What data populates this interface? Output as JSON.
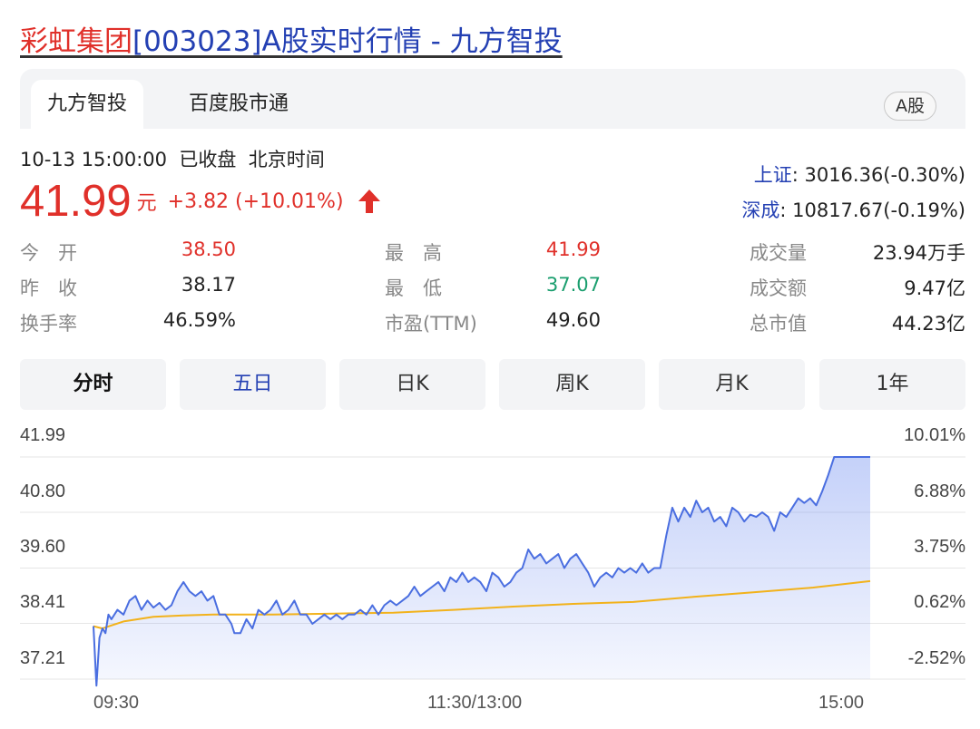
{
  "page": {
    "title_name": "彩虹集团",
    "title_rest": "[003023]A股实时行情 - 九方智投"
  },
  "tabs": [
    {
      "label": "九方智投",
      "active": true
    },
    {
      "label": "百度股市通",
      "active": false
    }
  ],
  "market_badge": "A股",
  "quote": {
    "datetime": "10-13 15:00:00",
    "status": "已收盘",
    "timezone": "北京时间",
    "price": "41.99",
    "unit": "元",
    "change": "+3.82 (+10.01%)",
    "color_up": "#e0302a",
    "color_down": "#1a9e6e"
  },
  "indices": [
    {
      "name": "上证",
      "value": ": 3016.36(-0.30%)"
    },
    {
      "name": "深成",
      "value": ": 10817.67(-0.19%)"
    }
  ],
  "stats": {
    "col1": [
      {
        "label": "今　开",
        "value": "38.50"
      },
      {
        "label": "昨　收",
        "value": "38.17"
      },
      {
        "label": "换手率",
        "value": "46.59%"
      }
    ],
    "col2": [
      {
        "label": "最　高",
        "value": "41.99"
      },
      {
        "label": "最　低",
        "value": "37.07"
      },
      {
        "label": "市盈(TTM)",
        "value": "49.60"
      }
    ],
    "col3": [
      {
        "label": "成交量",
        "value": "23.94万手"
      },
      {
        "label": "成交额",
        "value": "9.47亿"
      },
      {
        "label": "总市值",
        "value": "44.23亿"
      }
    ]
  },
  "ranges": [
    "分时",
    "五日",
    "日K",
    "周K",
    "月K",
    "1年"
  ],
  "chart_data": {
    "type": "line",
    "y_ticks": [
      "41.99",
      "40.80",
      "39.60",
      "38.41",
      "37.21"
    ],
    "y_pct_ticks": [
      "10.01%",
      "6.88%",
      "3.75%",
      "0.62%",
      "-2.52%"
    ],
    "x_ticks": [
      "09:30",
      "11:30/13:00",
      "15:00"
    ],
    "ylim": [
      37.21,
      41.99
    ],
    "prev_close": 38.17,
    "series": [
      {
        "role": "price",
        "color": "#4a6ee0",
        "points": [
          [
            0,
            38.35
          ],
          [
            1,
            37.07
          ],
          [
            2,
            38.1
          ],
          [
            3,
            38.3
          ],
          [
            4,
            38.2
          ],
          [
            5,
            38.6
          ],
          [
            6,
            38.5
          ],
          [
            8,
            38.7
          ],
          [
            10,
            38.6
          ],
          [
            12,
            38.9
          ],
          [
            14,
            39.0
          ],
          [
            16,
            38.7
          ],
          [
            18,
            38.9
          ],
          [
            20,
            38.75
          ],
          [
            22,
            38.85
          ],
          [
            24,
            38.7
          ],
          [
            26,
            38.8
          ],
          [
            28,
            39.1
          ],
          [
            30,
            39.3
          ],
          [
            32,
            39.1
          ],
          [
            34,
            39.0
          ],
          [
            36,
            39.1
          ],
          [
            38,
            38.9
          ],
          [
            40,
            39.0
          ],
          [
            42,
            38.6
          ],
          [
            44,
            38.6
          ],
          [
            46,
            38.4
          ],
          [
            47,
            38.2
          ],
          [
            49,
            38.2
          ],
          [
            51,
            38.5
          ],
          [
            53,
            38.3
          ],
          [
            55,
            38.7
          ],
          [
            57,
            38.6
          ],
          [
            59,
            38.7
          ],
          [
            61,
            38.9
          ],
          [
            63,
            38.6
          ],
          [
            65,
            38.7
          ],
          [
            67,
            38.9
          ],
          [
            69,
            38.6
          ],
          [
            71,
            38.6
          ],
          [
            73,
            38.4
          ],
          [
            75,
            38.5
          ],
          [
            77,
            38.6
          ],
          [
            79,
            38.5
          ],
          [
            81,
            38.6
          ],
          [
            83,
            38.5
          ],
          [
            85,
            38.6
          ],
          [
            87,
            38.6
          ],
          [
            89,
            38.7
          ],
          [
            91,
            38.6
          ],
          [
            93,
            38.8
          ],
          [
            95,
            38.6
          ],
          [
            97,
            38.8
          ],
          [
            99,
            38.9
          ],
          [
            101,
            38.8
          ],
          [
            103,
            38.9
          ],
          [
            105,
            39.0
          ],
          [
            107,
            39.2
          ],
          [
            109,
            39.0
          ],
          [
            111,
            39.1
          ],
          [
            113,
            39.2
          ],
          [
            115,
            39.3
          ],
          [
            117,
            39.1
          ],
          [
            119,
            39.4
          ],
          [
            121,
            39.3
          ],
          [
            123,
            39.5
          ],
          [
            125,
            39.3
          ],
          [
            127,
            39.4
          ],
          [
            129,
            39.3
          ],
          [
            131,
            39.1
          ],
          [
            133,
            39.5
          ],
          [
            135,
            39.4
          ],
          [
            137,
            39.2
          ],
          [
            139,
            39.3
          ],
          [
            141,
            39.5
          ],
          [
            143,
            39.6
          ],
          [
            145,
            40.0
          ],
          [
            147,
            39.8
          ],
          [
            149,
            39.9
          ],
          [
            151,
            39.7
          ],
          [
            153,
            39.8
          ],
          [
            155,
            39.9
          ],
          [
            157,
            39.6
          ],
          [
            159,
            39.8
          ],
          [
            161,
            39.9
          ],
          [
            163,
            39.7
          ],
          [
            165,
            39.5
          ],
          [
            167,
            39.2
          ],
          [
            169,
            39.4
          ],
          [
            171,
            39.5
          ],
          [
            173,
            39.4
          ],
          [
            175,
            39.6
          ],
          [
            177,
            39.5
          ],
          [
            179,
            39.6
          ],
          [
            181,
            39.5
          ],
          [
            183,
            39.7
          ],
          [
            185,
            39.5
          ],
          [
            187,
            39.6
          ],
          [
            189,
            39.6
          ],
          [
            191,
            40.3
          ],
          [
            193,
            40.9
          ],
          [
            195,
            40.6
          ],
          [
            197,
            40.9
          ],
          [
            199,
            40.7
          ],
          [
            201,
            41.05
          ],
          [
            203,
            40.8
          ],
          [
            205,
            40.9
          ],
          [
            207,
            40.6
          ],
          [
            209,
            40.7
          ],
          [
            211,
            40.5
          ],
          [
            213,
            40.9
          ],
          [
            215,
            40.8
          ],
          [
            217,
            40.6
          ],
          [
            219,
            40.75
          ],
          [
            221,
            40.7
          ],
          [
            223,
            40.8
          ],
          [
            225,
            40.7
          ],
          [
            227,
            40.4
          ],
          [
            229,
            40.8
          ],
          [
            231,
            40.7
          ],
          [
            233,
            40.9
          ],
          [
            235,
            41.1
          ],
          [
            237,
            41.0
          ],
          [
            239,
            41.1
          ],
          [
            241,
            40.95
          ],
          [
            243,
            41.25
          ],
          [
            245,
            41.6
          ],
          [
            247,
            41.99
          ],
          [
            259,
            41.99
          ]
        ]
      },
      {
        "role": "average",
        "color": "#f2b21b",
        "points": [
          [
            0,
            38.35
          ],
          [
            3,
            38.3
          ],
          [
            10,
            38.45
          ],
          [
            20,
            38.55
          ],
          [
            30,
            38.58
          ],
          [
            40,
            38.6
          ],
          [
            60,
            38.6
          ],
          [
            80,
            38.62
          ],
          [
            100,
            38.64
          ],
          [
            120,
            38.7
          ],
          [
            140,
            38.77
          ],
          [
            160,
            38.83
          ],
          [
            180,
            38.87
          ],
          [
            200,
            38.98
          ],
          [
            220,
            39.08
          ],
          [
            240,
            39.18
          ],
          [
            259,
            39.32
          ]
        ]
      }
    ]
  }
}
